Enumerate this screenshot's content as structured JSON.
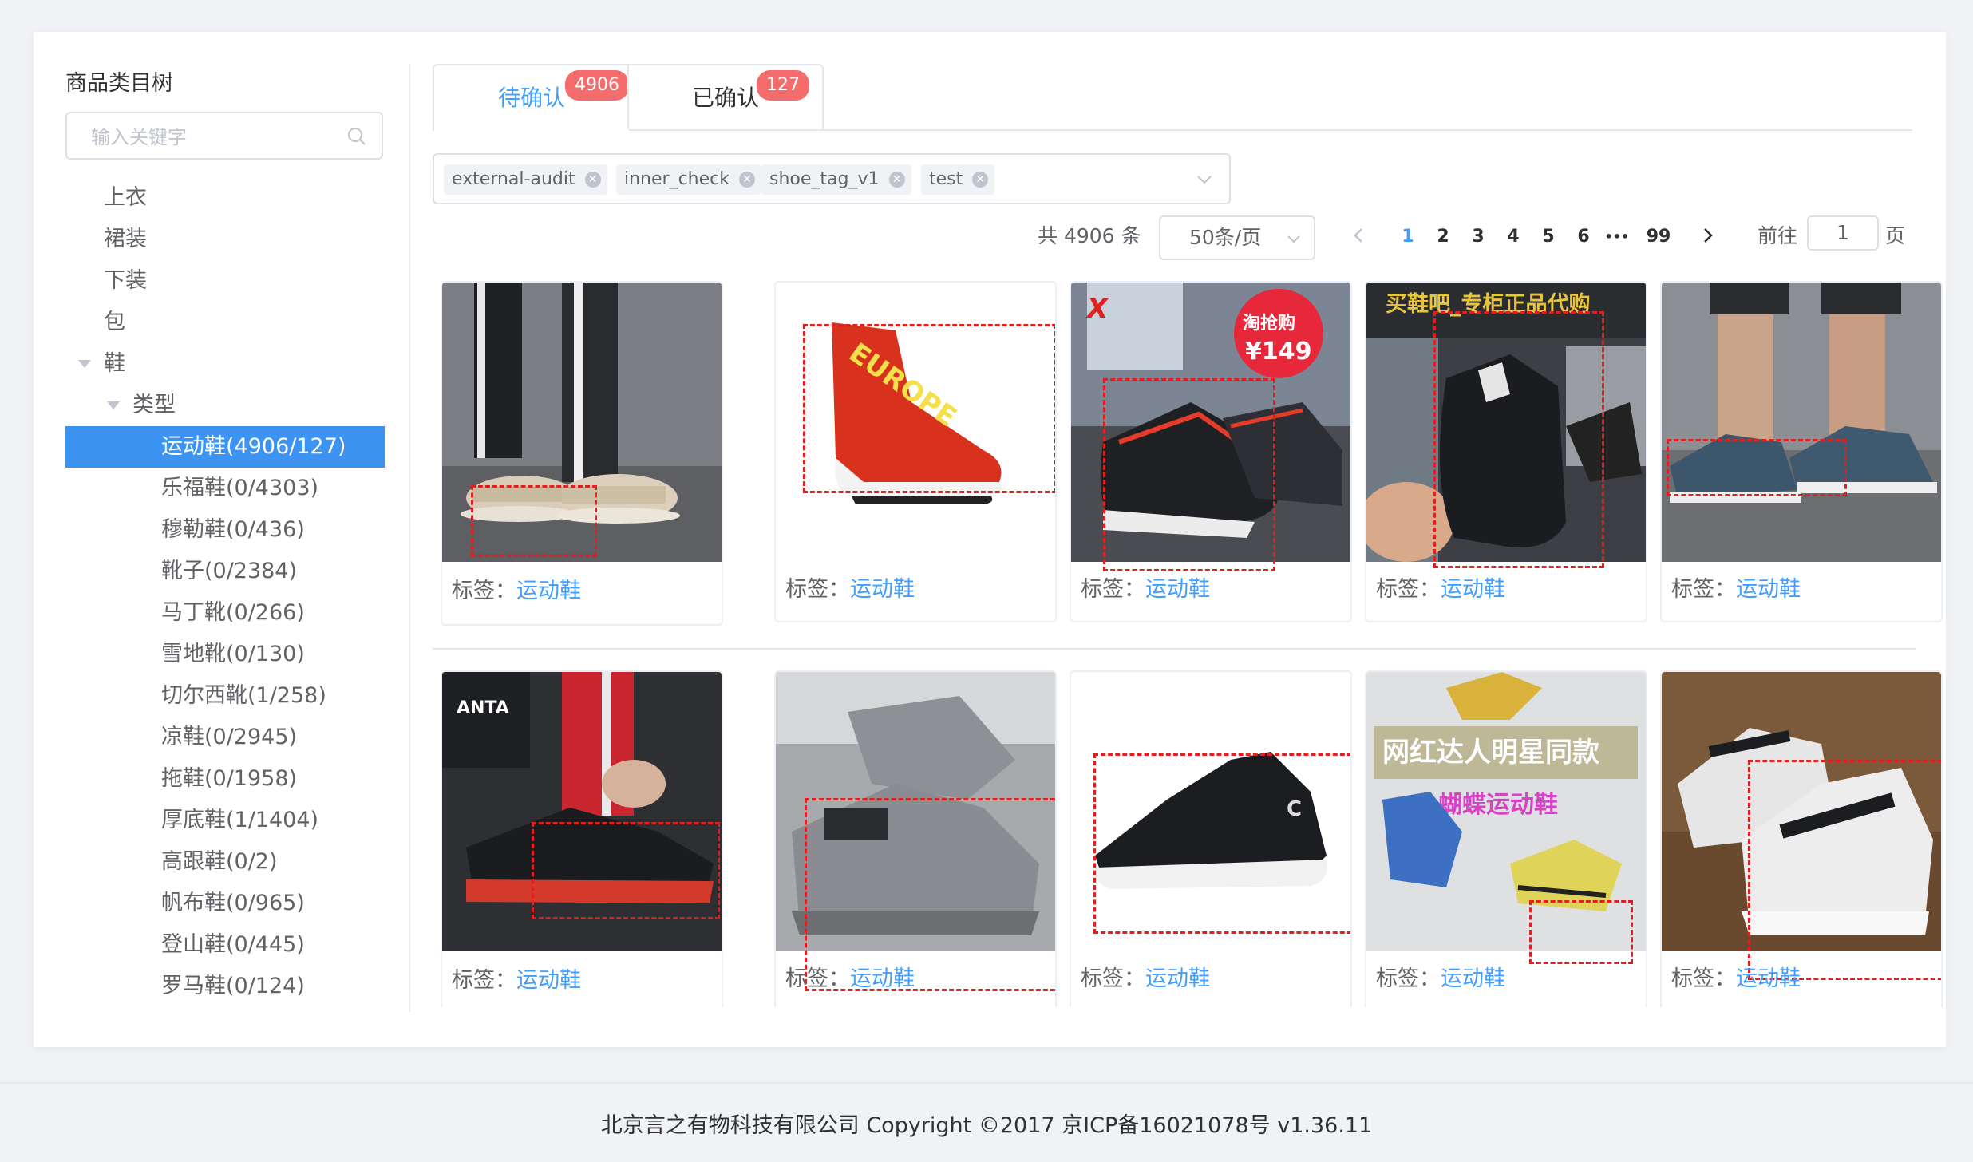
{
  "tree": {
    "title": "商品类目树",
    "search_placeholder": "输入关键字",
    "nodes": [
      {
        "label": "上衣"
      },
      {
        "label": "裙装"
      },
      {
        "label": "下装"
      },
      {
        "label": "包"
      },
      {
        "label": "鞋"
      },
      {
        "label": "类型"
      },
      {
        "label": "运动鞋(4906/127)"
      },
      {
        "label": "乐福鞋(0/4303)"
      },
      {
        "label": "穆勒鞋(0/436)"
      },
      {
        "label": "靴子(0/2384)"
      },
      {
        "label": "马丁靴(0/266)"
      },
      {
        "label": "雪地靴(0/130)"
      },
      {
        "label": "切尔西靴(1/258)"
      },
      {
        "label": "凉鞋(0/2945)"
      },
      {
        "label": "拖鞋(0/1958)"
      },
      {
        "label": "厚底鞋(1/1404)"
      },
      {
        "label": "高跟鞋(0/2)"
      },
      {
        "label": "帆布鞋(0/965)"
      },
      {
        "label": "登山鞋(0/445)"
      },
      {
        "label": "罗马鞋(0/124)"
      }
    ]
  },
  "tabs": [
    {
      "label": "待确认",
      "badge": "4906"
    },
    {
      "label": "已确认",
      "badge": "127"
    }
  ],
  "filter_tags": [
    "external-audit",
    "inner_check",
    "shoe_tag_v1",
    "test"
  ],
  "pagination": {
    "total": "共 4906 条",
    "page_size": "50条/页",
    "pages": [
      "1",
      "2",
      "3",
      "4",
      "5",
      "6",
      "•••",
      "99"
    ],
    "current": "1",
    "goto_prefix": "前往",
    "goto_value": "1",
    "goto_suffix": "页"
  },
  "items": [
    {
      "caption": "标签：",
      "label": "运动鞋"
    },
    {
      "caption": "标签：",
      "label": "运动鞋"
    },
    {
      "caption": "标签：",
      "label": "运动鞋"
    },
    {
      "caption": "标签：",
      "label": "运动鞋"
    },
    {
      "caption": "标签：",
      "label": "运动鞋"
    },
    {
      "caption": "标签：",
      "label": "运动鞋"
    },
    {
      "caption": "标签：",
      "label": "运动鞋"
    },
    {
      "caption": "标签：",
      "label": "运动鞋"
    },
    {
      "caption": "标签：",
      "label": "运动鞋"
    },
    {
      "caption": "标签：",
      "label": "运动鞋"
    }
  ],
  "image_text": {
    "item3_price": "¥149",
    "item3_promo": "淘抢购",
    "item4_banner": "买鞋吧_专柜正品代购",
    "item9_banner": "网红达人明星同款",
    "item9_sub": "蝴蝶运动鞋",
    "item2_print": "EUROPE"
  },
  "colors": {
    "primary": "#409eff",
    "active_bg": "#3c93f2",
    "badge": "#f56c6c",
    "bbox": "#e02020"
  },
  "footer": "北京言之有物科技有限公司 Copyright ©2017 京ICP备16021078号 v1.36.11"
}
